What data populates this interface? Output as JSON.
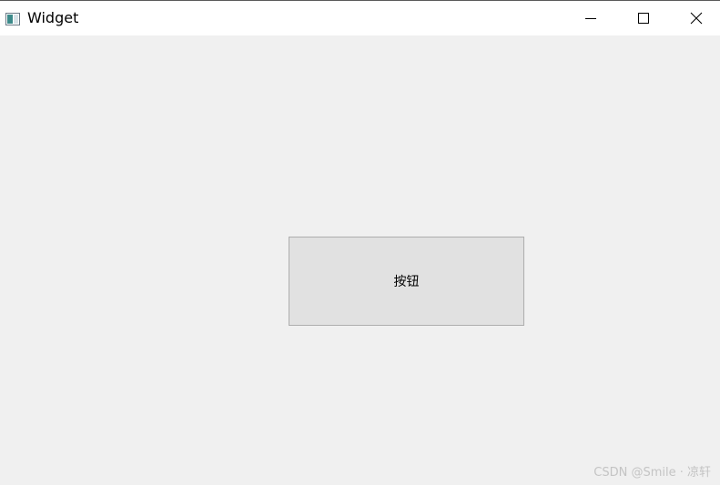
{
  "window": {
    "title": "Widget",
    "icon": "app-window-icon",
    "controls": {
      "minimize_icon": "minimize-icon",
      "maximize_icon": "maximize-icon",
      "close_icon": "close-icon"
    }
  },
  "main": {
    "button_label": "按钮"
  },
  "watermark": {
    "text": "CSDN @Smile · 凉轩"
  },
  "colors": {
    "client_background": "#f0f0f0",
    "titlebar_background": "#ffffff",
    "button_face": "#e1e1e1",
    "button_border": "#adadad"
  }
}
